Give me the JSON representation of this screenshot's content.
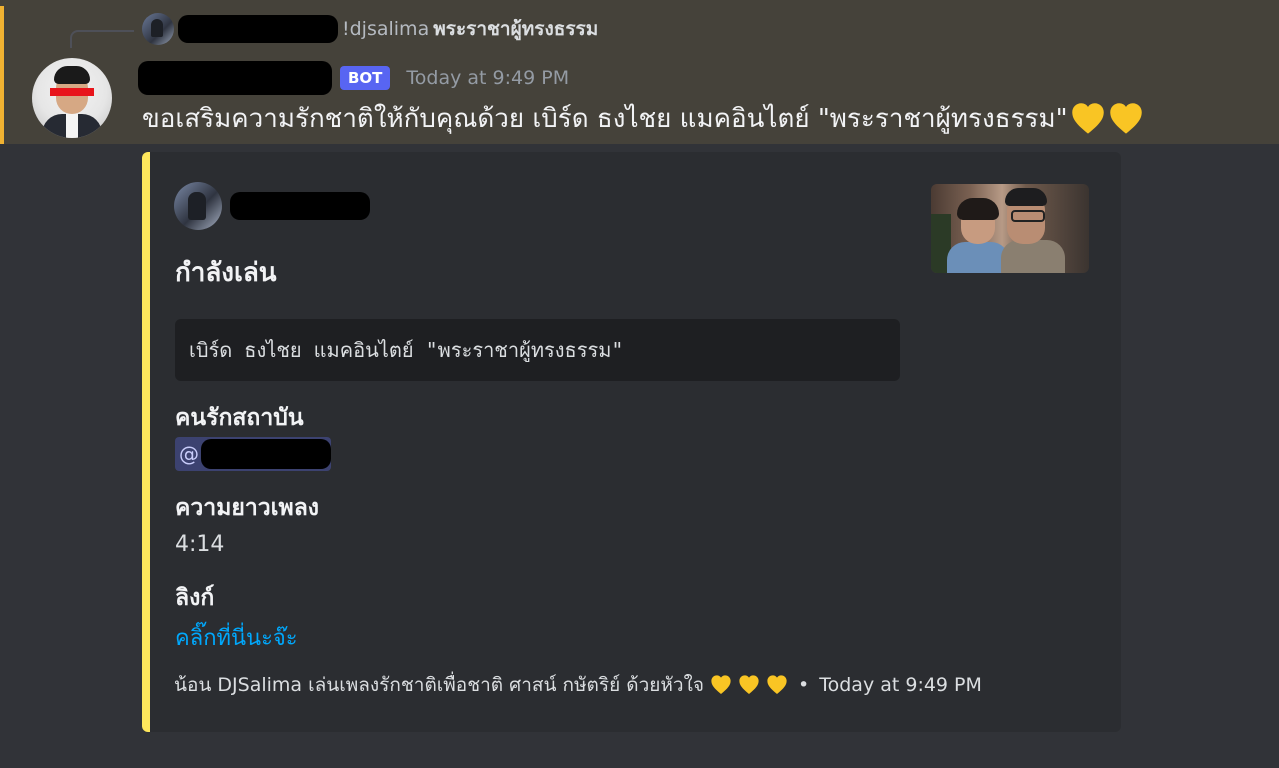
{
  "reply": {
    "username_redacted": "",
    "content_prefix": "!djsalima ",
    "content_title": "พระราชาผู้ทรงธรรม"
  },
  "message": {
    "username_redacted": "",
    "bot_tag": "BOT",
    "timestamp": "Today at 9:49 PM",
    "content": "ขอเสริมความรักชาติให้กับคุณด้วย เบิร์ด ธงไชย แมคอินไตย์ \"พระราชาผู้ทรงธรรม\"",
    "reaction_icons": [
      "yellow-heart-icon",
      "yellow-heart-icon"
    ]
  },
  "embed": {
    "accent_color": "#fee75c",
    "author_redacted": "",
    "title": "กำลังเล่น",
    "code_text": "เบิร์ด ธงไชย แมคอินไตย์ \"พระราชาผู้ทรงธรรม\"",
    "fields": [
      {
        "name": "คนรักสถาบัน",
        "value": "@"
      },
      {
        "name": "ความยาวเพลง",
        "value": "4:14"
      },
      {
        "name": "ลิงก์",
        "value": "คลิ๊กที่นี่นะจ๊ะ"
      }
    ],
    "footer": {
      "text": "น้อน DJSalima เล่นเพลงรักชาติเพื่อชาติ ศาสน์ กษัตริย์ ด้วยหัวใจ",
      "separator": "•",
      "timestamp": "Today at 9:49 PM"
    }
  },
  "colors": {
    "background": "#313338",
    "highlight": "#45423a",
    "highlight_bar": "#f0b232",
    "bot_tag": "#5865f2",
    "link": "#00a8fc",
    "heart": "#f9c524"
  }
}
